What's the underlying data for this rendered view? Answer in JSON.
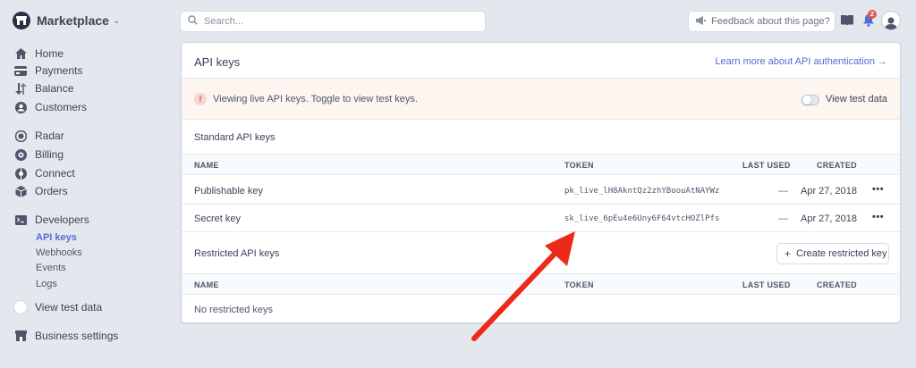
{
  "colors": {
    "accent": "#556cd6",
    "arrow": "#ed2a1a",
    "banner_bg": "#fcf5f0",
    "page_bg": "#e3e8ee"
  },
  "brand": {
    "name": "Marketplace",
    "icon": "building-icon"
  },
  "sidebar": {
    "items": [
      {
        "label": "Home",
        "icon": "home-icon"
      },
      {
        "label": "Payments",
        "icon": "credit-card-icon"
      },
      {
        "label": "Balance",
        "icon": "balance-arrows-icon"
      },
      {
        "label": "Customers",
        "icon": "person-icon"
      },
      {
        "label": "Radar",
        "icon": "radar-icon"
      },
      {
        "label": "Billing",
        "icon": "billing-icon"
      },
      {
        "label": "Connect",
        "icon": "connect-icon"
      },
      {
        "label": "Orders",
        "icon": "orders-box-icon"
      },
      {
        "label": "Developers",
        "icon": "terminal-icon"
      }
    ],
    "developer_subitems": [
      "API keys",
      "Webhooks",
      "Events",
      "Logs"
    ],
    "view_test_data": "View test data",
    "business_settings": {
      "label": "Business settings",
      "icon": "building-icon"
    }
  },
  "search": {
    "placeholder": "Search..."
  },
  "feedback": {
    "placeholder": "Feedback about this page?",
    "icon": "megaphone-icon"
  },
  "topbar": {
    "notification_count": "2",
    "docs_icon": "book-icon",
    "bell_icon": "bell-icon",
    "avatar_icon": "avatar-icon"
  },
  "card": {
    "title": "API keys",
    "learn_more": "Learn more about API authentication →",
    "banner": {
      "text": "Viewing live API keys. Toggle to view test keys.",
      "toggle_label": "View test data",
      "icon": "alert-icon"
    },
    "standard": {
      "title": "Standard API keys",
      "columns": [
        "NAME",
        "TOKEN",
        "LAST USED",
        "CREATED"
      ],
      "rows": [
        {
          "name": "Publishable key",
          "token": "pk_live_lH8AkntQz2zhYBoouAtNAYWz",
          "last_used": "—",
          "created": "Apr 27, 2018",
          "more": "•••"
        },
        {
          "name": "Secret key",
          "token": "sk_live_6pEu4e6Uny6F64vtcHOZlPfs",
          "last_used": "—",
          "created": "Apr 27, 2018",
          "more": "•••"
        }
      ]
    },
    "restricted": {
      "title": "Restricted API keys",
      "create_button": "Create restricted key",
      "columns": [
        "NAME",
        "TOKEN",
        "LAST USED",
        "CREATED"
      ],
      "empty": "No restricted keys"
    }
  }
}
